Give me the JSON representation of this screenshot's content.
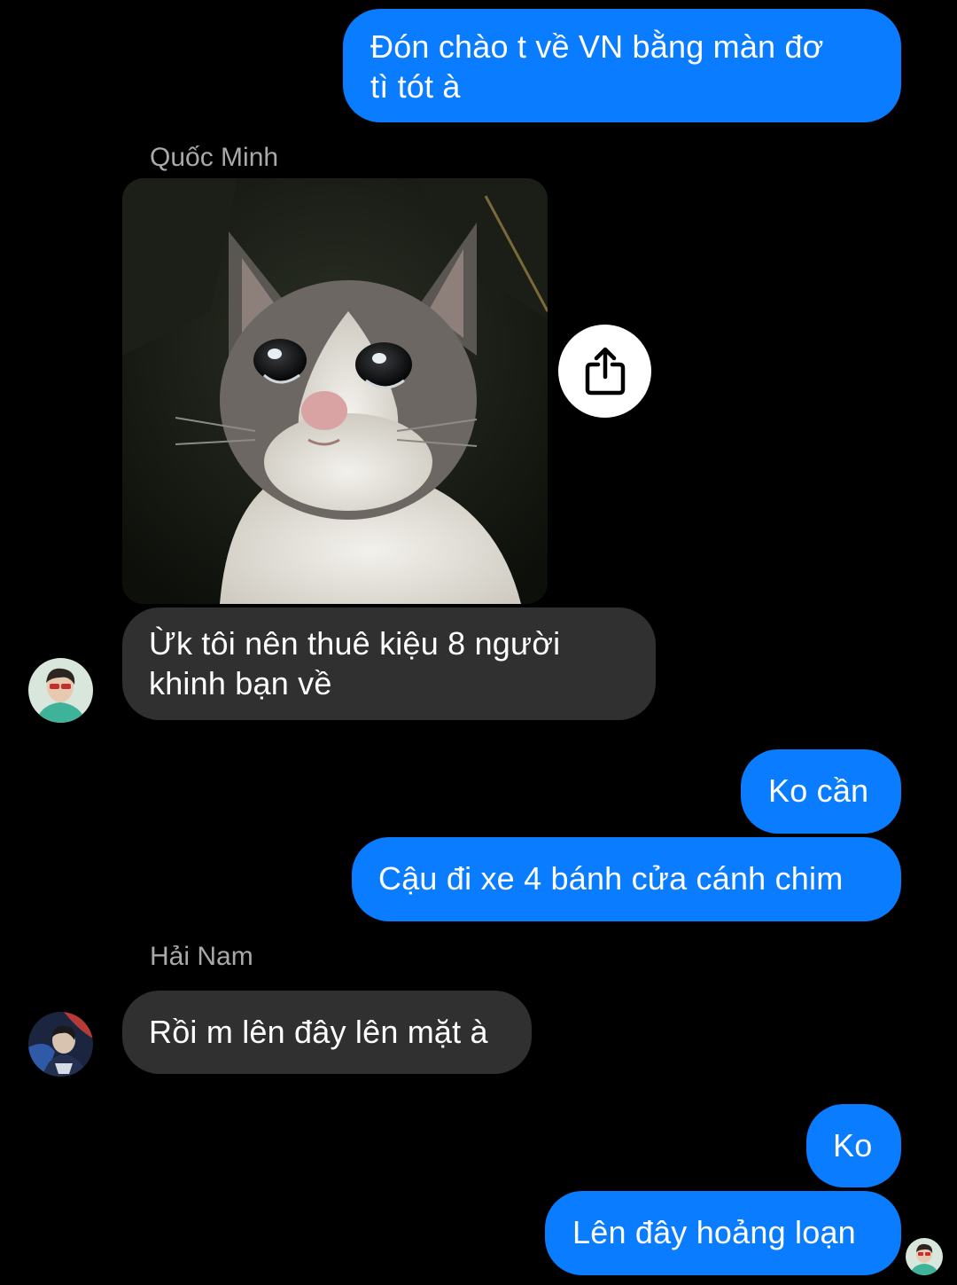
{
  "colors": {
    "background": "#000000",
    "outgoing_bubble": "#0a7cff",
    "incoming_bubble": "#303030",
    "sender_name": "#a9a9a9"
  },
  "messages": {
    "m1": {
      "direction": "outgoing",
      "text_line1": "Đón chào t về VN bằng màn đơ",
      "text_line2": "tì tót à"
    },
    "sender_quoc_minh": "Quốc Minh",
    "m2_image": {
      "icon": "crying-cat-image"
    },
    "share_icon": "share-icon",
    "m3": {
      "direction": "incoming",
      "text_line1": "Ừk tôi nên thuê kiệu 8 người",
      "text_line2": "khinh bạn về"
    },
    "m4": {
      "direction": "outgoing",
      "text": "Ko cần"
    },
    "m5": {
      "direction": "outgoing",
      "text": "Cậu đi xe 4 bánh cửa cánh chim"
    },
    "sender_hai_nam": "Hải Nam",
    "m6": {
      "direction": "incoming",
      "text": "Rồi m lên đây lên mặt à"
    },
    "m7": {
      "direction": "outgoing",
      "text": "Ko"
    },
    "m8": {
      "direction": "outgoing",
      "text": "Lên đây hoảng loạn"
    }
  }
}
